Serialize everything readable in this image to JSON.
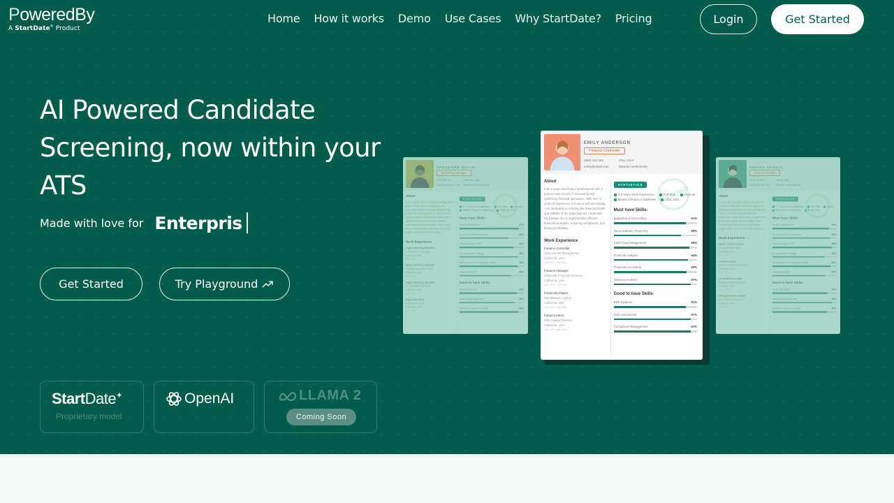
{
  "header": {
    "logo": {
      "brand_initial": "P",
      "brand_rest": "oweredBy",
      "sub_prefix": "A",
      "sub_brand": "StartDate",
      "sub_mark": "®",
      "sub_suffix": "Product"
    },
    "nav": [
      "Home",
      "How it works",
      "Demo",
      "Use Cases",
      "Why StartDate?",
      "Pricing"
    ],
    "login_label": "Login",
    "get_started_label": "Get Started"
  },
  "hero": {
    "headline": "AI Powered Candidate Screening, now within your ATS",
    "tagline_lead": "Made with love for",
    "tagline_word": "Enterpris",
    "cta_primary": "Get Started",
    "cta_secondary": "Try Playground",
    "cta_secondary_icon": "trending-up-icon"
  },
  "models": [
    {
      "name_bold": "Start",
      "name_rest": "Date",
      "mark": "✦",
      "subtitle": "Proprietary model",
      "icon": "startdate-logo"
    },
    {
      "name": "OpenAI",
      "icon": "openai-logo"
    },
    {
      "name": "LLAMA 2",
      "icon": "meta-logo",
      "badge": "Coming Soon"
    }
  ],
  "colors": {
    "brand": "#025c4b",
    "background": "#f1f8f5",
    "accent": "#1e7a68",
    "role_accent": "#e57e62"
  },
  "resumes": {
    "left": {
      "name": "THEODORE DEVIN",
      "role": "Marketing Manager",
      "phone": "(720) 456 789",
      "location": "California, USA",
      "email": "theodore@email.com",
      "link": "linkedin.com/in/theodore",
      "about_title": "About",
      "about": "I am a results-driven marketing manager with 5 years of experience in developing and executing strategic marketing initiatives. My passion for driving growth, combined with a strong analytical mindset, has consistently delivered measurable results, enabling campaigns and market reach. I have a track record of collaborating with cross-functional teams, delivering results for clients.",
      "work_title": "Work Experience",
      "jobs": [
        {
          "title": "Digital Marketing Executive",
          "company": "CreativeMind Marketing",
          "location": "California, USA",
          "dates": "2020 - 2023"
        },
        {
          "title": "Digital Marketing Strategist",
          "company": "Strategic Marketing Group",
          "location": "California, USA",
          "dates": "2019 - 2020"
        },
        {
          "title": "Digital Marketing Specialist",
          "company": "NexusOptima Marketing",
          "location": "California, USA",
          "dates": "2018 - 2019"
        },
        {
          "title": "Digital Marketing",
          "company": "BrightSpark Media",
          "location": "California, USA",
          "dates": "2017 - 2018"
        }
      ],
      "stats_label": "STATISTICS",
      "stats": [
        "5-7 Years Work Experience",
        "Full Time",
        "Remote",
        "Master's Degree in Marketing",
        "California, USA"
      ],
      "must_title": "Must have Skills-",
      "must": [
        {
          "name": "Project Management",
          "value": 97
        },
        {
          "name": "Product & Market Research",
          "value": 80
        },
        {
          "name": "Communication & PR",
          "value": 88
        },
        {
          "name": "Development & Testing",
          "value": 95
        },
        {
          "name": "Interpersonal Communication Skills",
          "value": 95
        },
        {
          "name": "Lead Generation",
          "value": 85
        }
      ],
      "good_title": "Good to have Skills-",
      "good": [
        {
          "name": "Email Marketing",
          "value": 94
        },
        {
          "name": "Social Media Marketing",
          "value": 90
        },
        {
          "name": "Influencer Negotiation Skills",
          "value": 96
        }
      ]
    },
    "main": {
      "name": "EMILY ANDERSON",
      "role": "Finance Controller",
      "phone": "(888) 444 555",
      "location": "Ohio, USA",
      "email": "emily@email.com",
      "link": "linkedin.com/in/emily",
      "about_title": "About",
      "about": "I am a seasoned finance professional with a proven track record of overseeing and optimising financial operations. With over 4 years of experience in finance and accounting, I am dedicated to ensuring the financial health and stability of the organisations I work with. My passion lies in implementing efficient financial strategies, ensuring compliance, and driving profitability.",
      "work_title": "Work Experience",
      "jobs": [
        {
          "title": "Finance Controller",
          "company": "Apex Wealth Management",
          "location": "California, USA",
          "dates": "July 2021 - Oct 2023"
        },
        {
          "title": "Finance manager",
          "company": "SilverOak Financial Services",
          "location": "California, USA",
          "dates": "Sept 2020 - Jun 2021"
        },
        {
          "title": "Financial Analyst",
          "company": "WealthWave Capital",
          "location": "California, USA",
          "dates": "Jun 2018 - Aug 2020"
        },
        {
          "title": "Finance Intern",
          "company": "Elite Capital Partners",
          "location": "California, USA",
          "dates": "Jan 2018 - May 2018"
        }
      ],
      "stats_label": "STATISTICS",
      "stats": [
        "3-5 Years Work Experience",
        "Full Time",
        "Remote",
        "Master's Degree in Business",
        "Ohio, USA"
      ],
      "must_title": "Must have Skills-",
      "must": [
        {
          "name": "Budgeting & Forecasting",
          "value": 91
        },
        {
          "name": "Tax & Statutory Reporting",
          "value": 85
        },
        {
          "name": "Cash Flow Management",
          "value": 96
        },
        {
          "name": "Financial Analysis",
          "value": 94
        },
        {
          "name": "Financial Accounting",
          "value": 92
        },
        {
          "name": "Variance Analysis",
          "value": 97
        }
      ],
      "good_title": "Good to have Skills-",
      "good": [
        {
          "name": "ERP Systems",
          "value": 91
        },
        {
          "name": "Risk Assessment",
          "value": 97
        },
        {
          "name": "Compliance Management",
          "value": 97
        }
      ],
      "stamp": "SCREENED"
    },
    "right": {
      "name": "SOPHIA GARCIA",
      "role": "Cost Accountant",
      "phone": "(555) 321 987",
      "location": "Texas, USA",
      "email": "sophia@email.com",
      "link": "linkedin.com/in/sgarcia",
      "about_title": "About",
      "about": "I am a highly motivated and results-oriented Cost Accountant with a strong background in analyzing financial data and cost allocation to improve efficiency and drive financial performance. With over 5 years of experience in cost and managerial accounting, I have consistently played a vital role in helping organizations optimize their cost structures.",
      "work_title": "Work Experience",
      "jobs": [
        {
          "title": "Senior Cost Accountant",
          "company": "PinnacleLedger Corp",
          "location": "California, USA",
          "dates": "2021 - 2023"
        },
        {
          "title": "Cost Accountant",
          "company": "Horizon Financial Strategies",
          "location": "California, USA",
          "dates": "2019 - 2021"
        },
        {
          "title": "Corporate Accountant",
          "company": "Sterling Financial Services",
          "location": "California, USA",
          "dates": "2018 - 2019"
        },
        {
          "title": "Management Accountant",
          "company": "Cornerstone Audit & Tax",
          "location": "California, USA",
          "dates": "2017 - 2018"
        }
      ],
      "stats_label": "STATISTICS",
      "stats": [
        "5-7 Years Work Experience",
        "Full Time",
        "Hybrid",
        "Bachelor's in Commerce",
        "Texas, USA"
      ],
      "must_title": "Must have Skills-",
      "must": [
        {
          "name": "Project Management",
          "value": 93
        },
        {
          "name": "Product & Market Research",
          "value": 95
        },
        {
          "name": "Communication & PR",
          "value": 98
        },
        {
          "name": "Development & Testing",
          "value": 86
        },
        {
          "name": "Interpersonal Communication Skills",
          "value": 96
        },
        {
          "name": "Lead Generation",
          "value": 87
        }
      ],
      "good_title": "Good to have Skills-",
      "good": [
        {
          "name": "Email Marketing",
          "value": 90
        },
        {
          "name": "Social Media Marketing",
          "value": 98
        },
        {
          "name": "Influencer Negotiation Skills",
          "value": 90
        }
      ]
    }
  }
}
